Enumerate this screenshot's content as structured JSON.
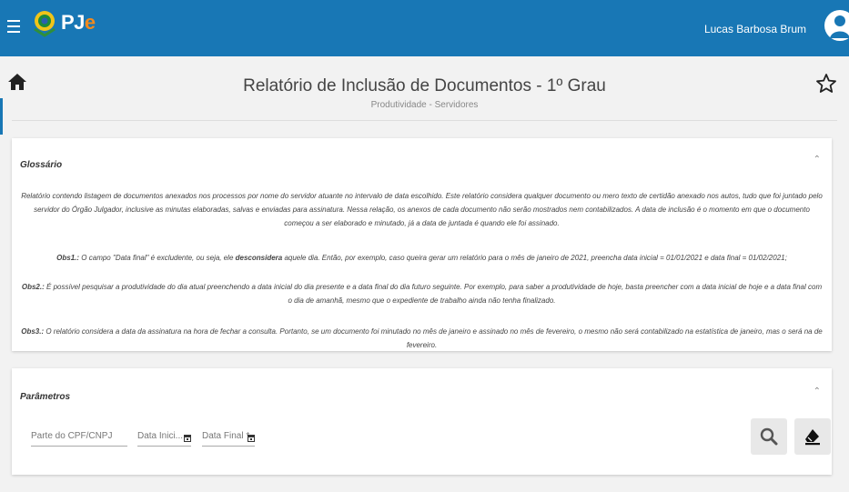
{
  "header": {
    "logo_main": "PJ",
    "logo_accent": "e",
    "user_name": "Lucas Barbosa Brum",
    "icons": [
      "menu-icon",
      "brasao-icon",
      "user-avatar-icon"
    ],
    "colors": {
      "bar": "#1877b5",
      "logo_accent": "#f28a1e"
    }
  },
  "page": {
    "title": "Relatório de Inclusão de Documentos - 1º Grau",
    "subtitle": "Produtividade - Servidores",
    "icons": [
      "home-icon",
      "star-icon"
    ]
  },
  "glossario": {
    "title": "Glossário",
    "intro": "Relatório contendo listagem de documentos anexados nos processos por nome do servidor atuante no intervalo de data escolhido. Este relatório considera qualquer documento ou mero texto de certidão anexado nos autos, tudo que foi juntado pelo servidor do Órgão Julgador, inclusive as minutas elaboradas, salvas e enviadas para assinatura. Nessa relação, os anexos de cada documento não serão mostrados nem contabilizados. A data de inclusão é o momento em que o documento começou a ser elaborado e minutado, já a data de juntada é quando ele foi assinado.",
    "obs1_label": "Obs1.:",
    "obs1_text_a": " O campo \"Data final\" é excludente, ou seja, ele ",
    "obs1_bold": "desconsidera",
    "obs1_text_b": " aquele dia. Então, por exemplo, caso queira gerar um relatório para o mês de janeiro de 2021, preencha data inicial = 01/01/2021 e data final = 01/02/2021;",
    "obs2_label": "Obs2.:",
    "obs2_text": " É possível pesquisar a produtividade do dia atual preenchendo a data inicial do dia presente e a data final do dia futuro seguinte. Por exemplo, para saber a produtividade de hoje, basta preencher com a data inicial de hoje e a data final com o dia de amanhã, mesmo que o expediente de trabalho ainda não tenha finalizado.",
    "obs3_label": "Obs3.:",
    "obs3_text": " O relatório considera a data da assinatura na hora de fechar a consulta. Portanto, se um documento foi minutado no mês de janeiro e assinado no mês de fevereiro, o mesmo não será contabilizado na estatística de janeiro, mas o será na de fevereiro."
  },
  "parametros": {
    "title": "Parâmetros",
    "cpf_placeholder": "Parte do CPF/CNPJ",
    "data_inicial_label": "Data Inici...",
    "data_final_label": "Data Final *",
    "icons": [
      "chevron-up-icon",
      "calendar-icon",
      "search-icon",
      "eraser-icon"
    ]
  }
}
